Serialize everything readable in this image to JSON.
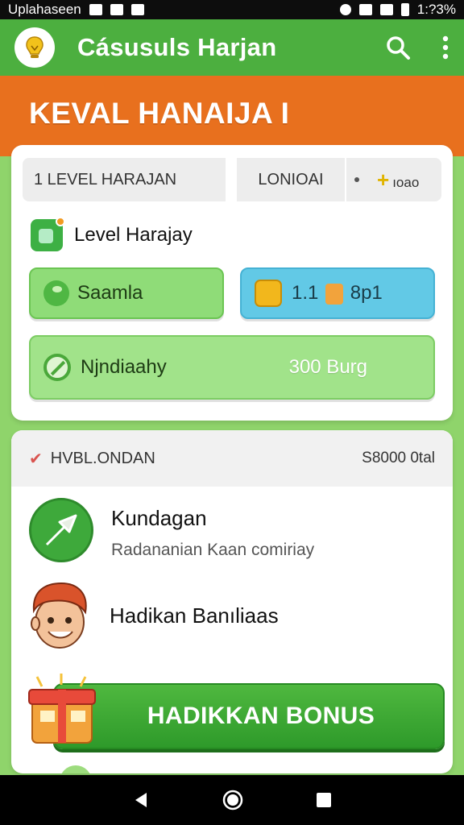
{
  "status_bar": {
    "left_text": "Uplahaseen",
    "time": "1:?3%"
  },
  "app_bar": {
    "title": "Cásusuls Harjan"
  },
  "banner": {
    "title": "KEVAL HANAIJA I"
  },
  "tabs": {
    "tab1": "1 LEVEL HARAJAN",
    "tab2": "LONIOAI",
    "tab3": "ıoao"
  },
  "level": {
    "label": "Level Harajay"
  },
  "buttons": {
    "green_label": "Saamla",
    "blue_value_left": "1.1",
    "blue_value_right": "8p1",
    "wide_label": "Njndiaahy",
    "wide_amount": "300 Burg"
  },
  "list": {
    "header_left": "HVBL.ONDAN",
    "header_right": "S8000 0tal",
    "item1_title": "Kundagan",
    "item1_subtitle": "Radananian Kaan comiriay",
    "item2_title": "Hadikan Banıliaas",
    "bonus_label": "HADIKKAN BONUS"
  },
  "colors": {
    "app_bar": "#4caf3f",
    "banner": "#e8701e",
    "background": "#8fd46b",
    "bonus": "#3aa832"
  }
}
